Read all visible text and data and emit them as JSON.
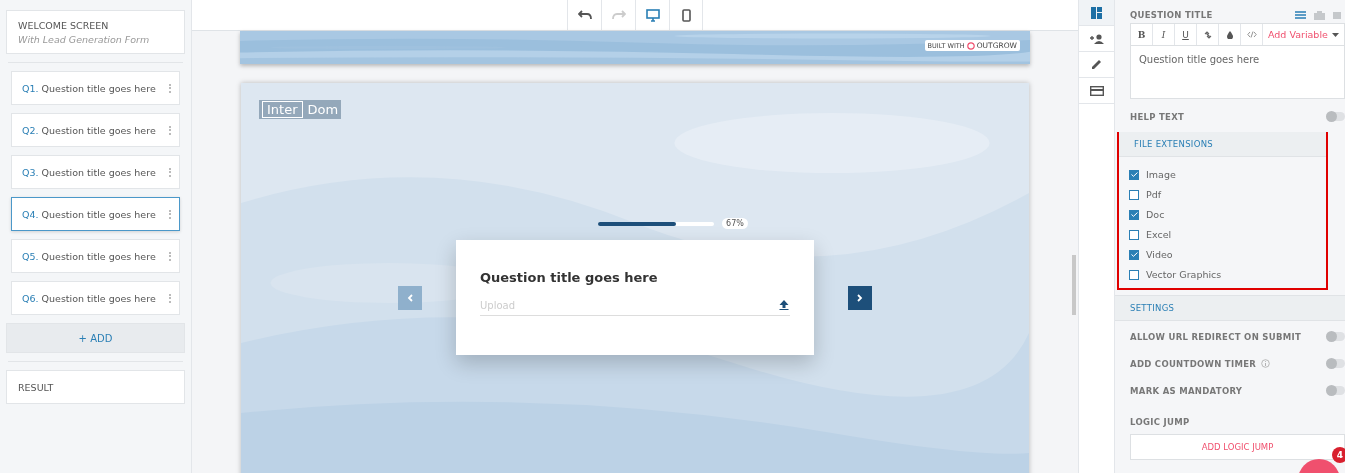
{
  "sidebar": {
    "welcome": {
      "title": "WELCOME SCREEN",
      "subtitle": "With Lead Generation Form"
    },
    "questions": [
      {
        "number": "Q1.",
        "title": "Question title goes here",
        "selected": false
      },
      {
        "number": "Q2.",
        "title": "Question title goes here",
        "selected": false
      },
      {
        "number": "Q3.",
        "title": "Question title goes here",
        "selected": false
      },
      {
        "number": "Q4.",
        "title": "Question title goes here",
        "selected": true
      },
      {
        "number": "Q5.",
        "title": "Question title goes here",
        "selected": false
      },
      {
        "number": "Q6.",
        "title": "Question title goes here",
        "selected": false
      }
    ],
    "add_button": "+ ADD",
    "result": "RESULT"
  },
  "toolbar": {
    "buttons": [
      {
        "kind": "undo",
        "disabled": false,
        "selected": false
      },
      {
        "kind": "redo",
        "disabled": true,
        "selected": false
      },
      {
        "kind": "desktop",
        "disabled": false,
        "selected": true
      },
      {
        "kind": "mobile",
        "disabled": false,
        "selected": false
      }
    ]
  },
  "preview": {
    "badge": {
      "prefix": "BUILT WITH",
      "brand": "OUTGROW"
    },
    "logo": [
      "Inter",
      "Dom"
    ],
    "progress": {
      "level": 0.67,
      "reading": "67%"
    },
    "question": {
      "title": "Question title goes here",
      "placeholder": "Upload"
    }
  },
  "side_tabs": [
    {
      "kind": "layout",
      "selected": true
    },
    {
      "kind": "person-add",
      "selected": false
    },
    {
      "kind": "pen",
      "selected": false
    },
    {
      "kind": "card",
      "selected": false
    }
  ],
  "panel": {
    "question_title": {
      "label": "QUESTION TITLE",
      "format_buttons": [
        "B",
        "I",
        "U"
      ],
      "add_variable": "Add Variable",
      "value": "Question title goes here"
    },
    "help_text": {
      "label": "HELP TEXT",
      "on": false
    },
    "file_extensions": {
      "label": "FILE EXTENSIONS",
      "items": [
        {
          "label": "Image",
          "checked": true
        },
        {
          "label": "Pdf",
          "checked": false
        },
        {
          "label": "Doc",
          "checked": true
        },
        {
          "label": "Excel",
          "checked": false
        },
        {
          "label": "Video",
          "checked": true
        },
        {
          "label": "Vector Graphics",
          "checked": false
        }
      ]
    },
    "settings": {
      "label": "SETTINGS",
      "toggles": [
        {
          "label": "ALLOW URL REDIRECT ON SUBMIT",
          "on": false,
          "info": false
        },
        {
          "label": "ADD COUNTDOWN TIMER",
          "on": false,
          "info": true
        },
        {
          "label": "MARK AS MANDATORY",
          "on": false,
          "info": false
        }
      ]
    },
    "logic_jump": {
      "label": "LOGIC JUMP",
      "button": "ADD LOGIC JUMP"
    }
  },
  "chat": {
    "badge": "4"
  }
}
